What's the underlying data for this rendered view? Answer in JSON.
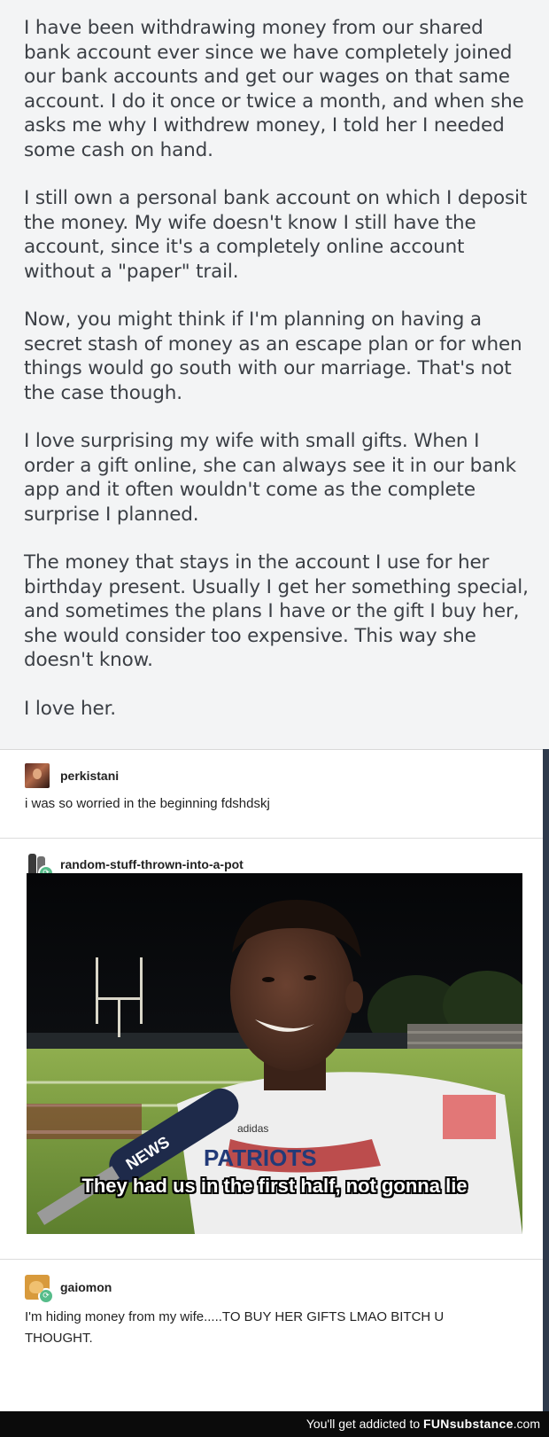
{
  "story": {
    "paragraphs": [
      "I have been withdrawing money from our shared bank account ever since we have completely joined our bank accounts and get our wages on that same account. I do it once or twice a month, and when she asks me why I withdrew money, I told her I needed some cash on hand.",
      "I still own a personal bank account on which I deposit the money. My wife doesn't know I still have the account, since it's a completely online account without a \"paper\" trail.",
      "Now, you might think if I'm planning on having a secret stash of money as an escape plan or for when things would go south with our marriage. That's not the case though.",
      "I love surprising my wife with small gifts. When I order a gift online, she can always see it in our bank app and it often wouldn't come as the complete surprise I planned.",
      "The money that stays in the account I use for her birthday present. Usually I get her something special, and sometimes the plans I have or the gift I buy her, she would consider too expensive. This way she doesn't know.",
      "I love her."
    ]
  },
  "replies": [
    {
      "username": "perkistani",
      "text": "i was so worried in the beginning fdshdskj",
      "avatar_icon": "user-avatar-icon"
    },
    {
      "username": "random-stuff-thrown-into-a-pot",
      "avatar_icon": "user-avatar-icon",
      "badge_icon": "reblog-icon"
    },
    {
      "username": "gaiomon",
      "text": "I'm hiding money from my wife.....TO BUY HER GIFTS LMAO BITCH U THOUGHT.",
      "avatar_icon": "user-avatar-icon",
      "badge_icon": "reblog-icon"
    }
  ],
  "meme": {
    "caption": "They had us in the first half, not gonna lie",
    "mic_label": "NEWS",
    "jersey_text": "PATRIOTS",
    "shirt_brand": "adidas"
  },
  "footer": {
    "tagline": "You'll get addicted to",
    "brand_strong": "FUNsubstance",
    "brand_suffix": ".com"
  },
  "colors": {
    "story_bg": "#f3f4f5",
    "story_text": "#3b3f45",
    "reblog_badge": "#56bc8a",
    "footer_bg": "#0b0b0b"
  }
}
